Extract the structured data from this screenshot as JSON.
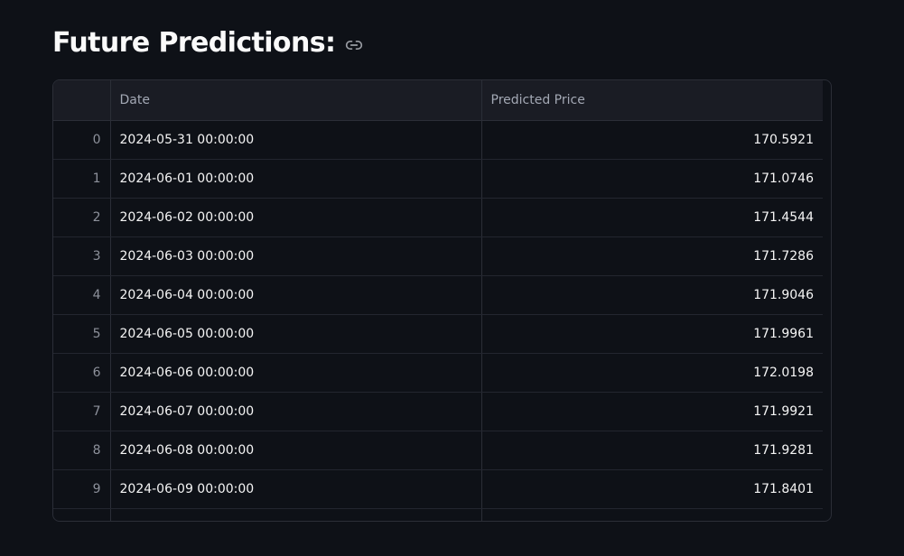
{
  "section": {
    "title": "Future Predictions:",
    "link_icon": "link-icon"
  },
  "table": {
    "columns": [
      "",
      "Date",
      "Predicted Price"
    ],
    "rows": [
      {
        "index": "0",
        "date": "2024-05-31 00:00:00",
        "price": "170.5921"
      },
      {
        "index": "1",
        "date": "2024-06-01 00:00:00",
        "price": "171.0746"
      },
      {
        "index": "2",
        "date": "2024-06-02 00:00:00",
        "price": "171.4544"
      },
      {
        "index": "3",
        "date": "2024-06-03 00:00:00",
        "price": "171.7286"
      },
      {
        "index": "4",
        "date": "2024-06-04 00:00:00",
        "price": "171.9046"
      },
      {
        "index": "5",
        "date": "2024-06-05 00:00:00",
        "price": "171.9961"
      },
      {
        "index": "6",
        "date": "2024-06-06 00:00:00",
        "price": "172.0198"
      },
      {
        "index": "7",
        "date": "2024-06-07 00:00:00",
        "price": "171.9921"
      },
      {
        "index": "8",
        "date": "2024-06-08 00:00:00",
        "price": "171.9281"
      },
      {
        "index": "9",
        "date": "2024-06-09 00:00:00",
        "price": "171.8401"
      }
    ]
  },
  "colors": {
    "background": "#0e1117",
    "header_background": "#1a1c24",
    "border": "#2b2e37",
    "text": "#fafafa",
    "muted_text": "#a3a8b4"
  }
}
